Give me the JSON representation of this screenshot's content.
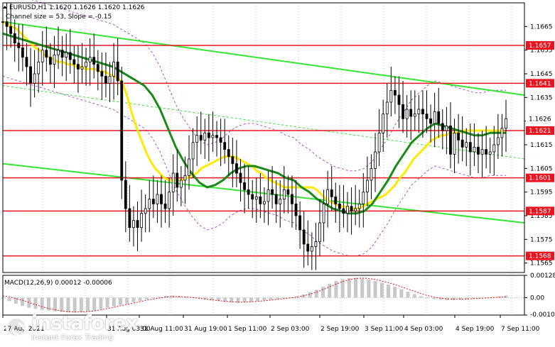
{
  "header": {
    "symbol_line": "EURUSD,H1  1.1620 1.1626 1.1620 1.1626",
    "channel_line": "Channel size = 53, Slope = -0.15"
  },
  "macd": {
    "label": "MACD(12,26,9) 0.00012 -0.00006",
    "ticks": [
      "0.00128",
      "0.00",
      "-0.00100"
    ]
  },
  "brand": {
    "name": "instaforex",
    "tagline": "Instant Forex Trading"
  },
  "colors": {
    "level_line": "#e8141e",
    "channel": "#33e633",
    "ma_fast": "#ffea00",
    "ma_slow": "#1b8a1b",
    "envelope": "#b44cd6",
    "macd_hist": "#c8c8c8",
    "macd_signal": "#e8141e",
    "candle": "#000000"
  },
  "chart_data": {
    "type": "candlestick",
    "symbol": "EURUSD",
    "timeframe": "H1",
    "ylim": [
      1.1561,
      1.1675
    ],
    "price_ticks": [
      "1.1665",
      "1.1655",
      "1.1645",
      "1.1635",
      "1.1625",
      "1.1615",
      "1.1605",
      "1.1595",
      "1.1585",
      "1.1575",
      "1.1565"
    ],
    "time_ticks": [
      "27 Aug 2021",
      "31 Aug 03:00",
      "31 Aug 11:00",
      "31 Aug 19:00",
      "1 Sep 11:00",
      "2 Sep 03:00",
      "2 Sep 19:00",
      "3 Sep 11:00",
      "4 Sep 03:00",
      "4 Sep 19:00",
      "7 Sep 11:00"
    ],
    "levels": [
      {
        "label": "1.1657",
        "value": 1.1657
      },
      {
        "label": "1.1641",
        "value": 1.1641
      },
      {
        "label": "1.1621",
        "value": 1.1621
      },
      {
        "label": "1.1601",
        "value": 1.1601
      },
      {
        "label": "1.1587",
        "value": 1.1587
      },
      {
        "label": "1.1568",
        "value": 1.1568
      }
    ],
    "current_price": {
      "label": "1.1626",
      "value": 1.1626
    },
    "close_series": [
      1.1667,
      1.1665,
      1.1662,
      1.1658,
      1.1656,
      1.1652,
      1.1648,
      1.1641,
      1.1645,
      1.165,
      1.1655,
      1.1652,
      1.1649,
      1.1653,
      1.1655,
      1.1652,
      1.1654,
      1.1651,
      1.1649,
      1.1647,
      1.1648,
      1.165,
      1.1652,
      1.1649,
      1.1646,
      1.1644,
      1.1641,
      1.1644,
      1.165,
      1.1642,
      1.16,
      1.1588,
      1.158,
      1.1583,
      1.158,
      1.1586,
      1.1588,
      1.1592,
      1.159,
      1.1594,
      1.159,
      1.1588,
      1.1595,
      1.1603,
      1.1597,
      1.16,
      1.1602,
      1.1609,
      1.1616,
      1.1619,
      1.1617,
      1.162,
      1.1618,
      1.1619,
      1.1618,
      1.1616,
      1.1613,
      1.161,
      1.1607,
      1.1603,
      1.1599,
      1.1596,
      1.1594,
      1.1592,
      1.1593,
      1.159,
      1.1591,
      1.1596,
      1.1594,
      1.159,
      1.1592,
      1.1596,
      1.1594,
      1.159,
      1.1585,
      1.1579,
      1.1573,
      1.157,
      1.1572,
      1.1574,
      1.1582,
      1.159,
      1.1596,
      1.1593,
      1.159,
      1.1588,
      1.1586,
      1.1589,
      1.1587,
      1.1588,
      1.159,
      1.1595,
      1.16,
      1.1605,
      1.1612,
      1.162,
      1.1628,
      1.1633,
      1.1638,
      1.1636,
      1.1632,
      1.1626,
      1.163,
      1.1627,
      1.1628,
      1.163,
      1.1628,
      1.1626,
      1.1624,
      1.1629,
      1.1624,
      1.1621,
      1.1623,
      1.1611,
      1.162,
      1.1617,
      1.1614,
      1.1616,
      1.1612,
      1.1614,
      1.1611,
      1.1613,
      1.1611,
      1.1612,
      1.1615,
      1.1618,
      1.1622,
      1.1626
    ],
    "ma_fast": [
      1.1667,
      1.1666,
      1.1665,
      1.1664,
      1.1662,
      1.166,
      1.1658,
      1.1656,
      1.1655,
      1.1653,
      1.1652,
      1.1651,
      1.165,
      1.165,
      1.1649,
      1.1649,
      1.1648,
      1.1648,
      1.1647,
      1.1647,
      1.1647,
      1.1646,
      1.1646,
      1.1645,
      1.1644,
      1.1643,
      1.1641,
      1.1635,
      1.1628,
      1.1622,
      1.1617,
      1.1612,
      1.1608,
      1.1605,
      1.1603,
      1.1601,
      1.16,
      1.16,
      1.16,
      1.16,
      1.1601,
      1.1602,
      1.1603,
      1.1605,
      1.1606,
      1.1607,
      1.1608,
      1.1609,
      1.161,
      1.161,
      1.161,
      1.1609,
      1.1608,
      1.1607,
      1.1606,
      1.1604,
      1.1603,
      1.1601,
      1.16,
      1.1599,
      1.1598,
      1.1597,
      1.1597,
      1.1597,
      1.1597,
      1.1597,
      1.1597,
      1.1597,
      1.1596,
      1.1594,
      1.1592,
      1.1591,
      1.159,
      1.1589,
      1.1589,
      1.1588,
      1.1588,
      1.1588,
      1.1589,
      1.159,
      1.1591,
      1.1592,
      1.1593,
      1.1594,
      1.1596,
      1.1598,
      1.1601,
      1.1603,
      1.1606,
      1.1609,
      1.1611,
      1.1613,
      1.1615,
      1.1617,
      1.1618,
      1.1619,
      1.1619,
      1.162,
      1.162,
      1.162,
      1.1621,
      1.1621,
      1.1621,
      1.1621,
      1.1621,
      1.1621,
      1.1621,
      1.1621,
      1.1621,
      1.162
    ],
    "ma_slow": [
      1.1662,
      1.1661,
      1.166,
      1.1659,
      1.1658,
      1.1657,
      1.1656,
      1.1655,
      1.1654,
      1.1653,
      1.1652,
      1.1651,
      1.165,
      1.1649,
      1.1648,
      1.1646,
      1.1644,
      1.1642,
      1.164,
      1.1636,
      1.163,
      1.1622,
      1.1614,
      1.1608,
      1.1603,
      1.1599,
      1.1597,
      1.1598,
      1.16,
      1.1603,
      1.1605,
      1.1606,
      1.1606,
      1.1605,
      1.1604,
      1.1603,
      1.1601,
      1.16,
      1.1597,
      1.1595,
      1.1592,
      1.159,
      1.1588,
      1.1587,
      1.1586,
      1.1586,
      1.1587,
      1.159,
      1.1595,
      1.16,
      1.1606,
      1.1611,
      1.1616,
      1.1619,
      1.1622,
      1.1624,
      1.1623,
      1.1622,
      1.1621,
      1.162,
      1.1619,
      1.1619,
      1.162,
      1.162,
      1.162
    ],
    "macd_hist": [
      -5e-05,
      -0.0002,
      -0.00035,
      -0.00048,
      -0.00058,
      -0.00064,
      -0.0007,
      -0.00074,
      -0.00078,
      -0.00082,
      -0.00085,
      -0.00086,
      -0.00084,
      -0.0008,
      -0.00074,
      -0.00066,
      -0.00058,
      -0.0005,
      -0.00042,
      -0.00034,
      -0.00026,
      -0.00018,
      -0.0001,
      -2e-05,
      4e-05,
      0.0001,
      0.00012,
      0.0001,
      6e-05,
      2e-05,
      -4e-05,
      -0.0001,
      -0.00016,
      -0.0002,
      -0.00024,
      -0.00028,
      -0.0003,
      -0.00028,
      -0.00024,
      -0.0002,
      -0.00016,
      -0.00012,
      -8e-05,
      -4e-05,
      2e-05,
      8e-05,
      0.00018,
      0.0003,
      0.00045,
      0.00062,
      0.0008,
      0.00095,
      0.00106,
      0.00112,
      0.00114,
      0.0011,
      0.00104,
      0.00095,
      0.00085,
      0.00075,
      0.00062,
      0.00048,
      0.00034,
      0.0002,
      8e-05,
      -2e-05,
      -8e-05,
      -0.00012,
      -0.00014,
      -0.00014,
      -0.00012,
      -0.0001,
      -8e-05,
      -4e-05,
      0.0,
      4e-05,
      8e-05,
      0.00012
    ],
    "macd_signal": [
      0.0001,
      5e-05,
      -5e-05,
      -0.00015,
      -0.00028,
      -0.0004,
      -0.00052,
      -0.00062,
      -0.0007,
      -0.00076,
      -0.0008,
      -0.00082,
      -0.00082,
      -0.0008,
      -0.00076,
      -0.0007,
      -0.00063,
      -0.00055,
      -0.00047,
      -0.00039,
      -0.00031,
      -0.00023,
      -0.00015,
      -8e-05,
      -2e-05,
      3e-05,
      6e-05,
      6e-05,
      4e-05,
      1e-05,
      -3e-05,
      -8e-05,
      -0.00013,
      -0.00017,
      -0.00021,
      -0.00024,
      -0.00026,
      -0.00026,
      -0.00024,
      -0.00021,
      -0.00018,
      -0.00014,
      -0.0001,
      -6e-05,
      -2e-05,
      3e-05,
      0.0001,
      0.0002,
      0.00032,
      0.00046,
      0.00062,
      0.00078,
      0.00092,
      0.00103,
      0.0011,
      0.00112,
      0.0011,
      0.00104,
      0.00096,
      0.00086,
      0.00075,
      0.00062,
      0.00049,
      0.00036,
      0.00023,
      0.00012,
      3e-05,
      -3e-05,
      -7e-05,
      -9e-05,
      -9e-05,
      -8e-05,
      -6e-05,
      -4e-05,
      -2e-05,
      0.0,
      2e-05,
      4e-05
    ]
  }
}
